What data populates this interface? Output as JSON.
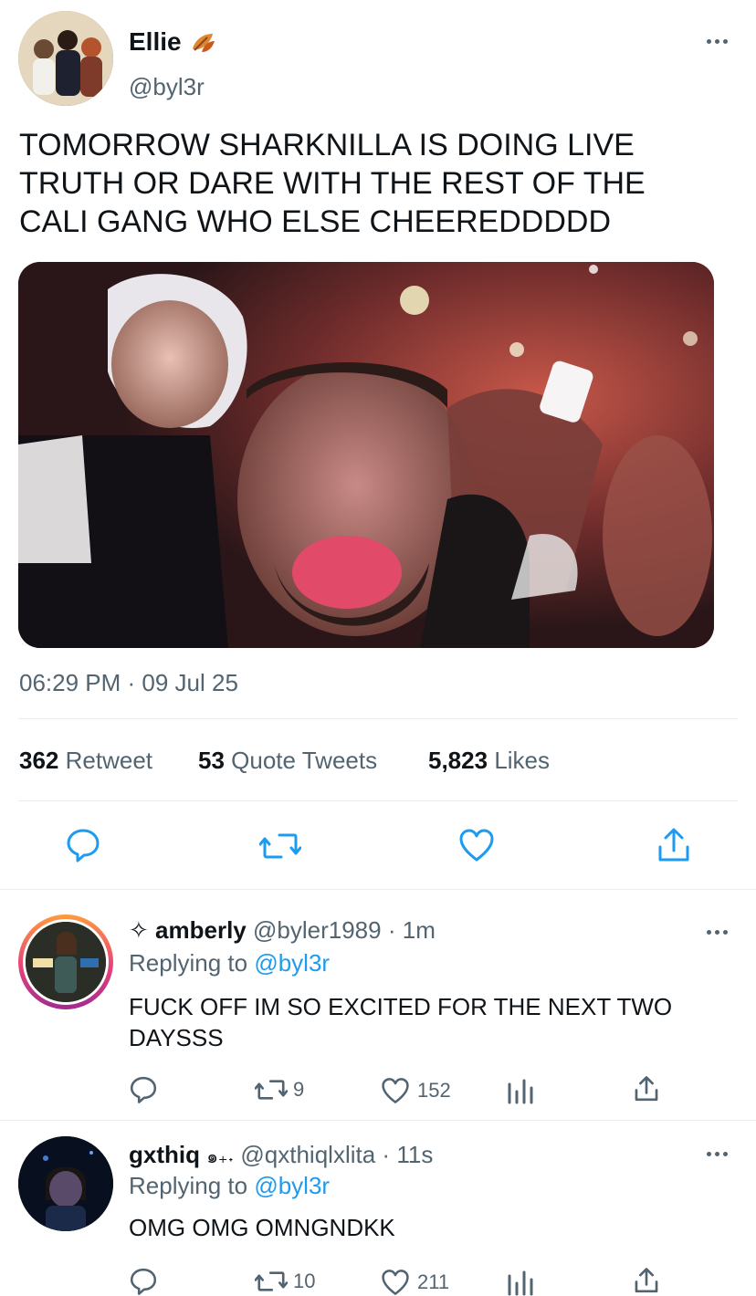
{
  "tweet": {
    "display_name": "Ellie",
    "name_emoji": "leaf-emoji",
    "handle": "@byl3r",
    "text": "TOMORROW SHARKNILLA IS DOING LIVE TRUTH OR DARE WITH THE REST OF THE CALI GANG WHO ELSE CHEEREDDDDD",
    "timestamp": "06:29 PM · 09 Jul 25",
    "stats": {
      "retweets_count": "362",
      "retweets_label": "Retweet",
      "quotes_count": "53",
      "quotes_label": "Quote Tweets",
      "likes_count": "5,823",
      "likes_label": "Likes"
    }
  },
  "replies": [
    {
      "prefix": "✧",
      "display_name": "amberly",
      "handle": "@byler1989",
      "sep": "·",
      "time": "1m",
      "replying_label": "Replying to",
      "replying_to": "@byl3r",
      "text": "FUCK OFF IM SO EXCITED FOR THE NEXT TWO DAYSSS",
      "retweets": "9",
      "likes": "152"
    },
    {
      "display_name": "gxthiq",
      "name_suffix": "๑₊˖",
      "handle": "@qxthiqlxlita",
      "sep": "·",
      "time": "11s",
      "replying_label": "Replying to",
      "replying_to": "@byl3r",
      "text": "OMG OMG OMNGNDKK",
      "retweets": "10",
      "likes": "211"
    }
  ],
  "colors": {
    "accent": "#1d9bf0",
    "muted": "#536471",
    "text": "#0f1419",
    "divider": "#e6ecf0"
  }
}
